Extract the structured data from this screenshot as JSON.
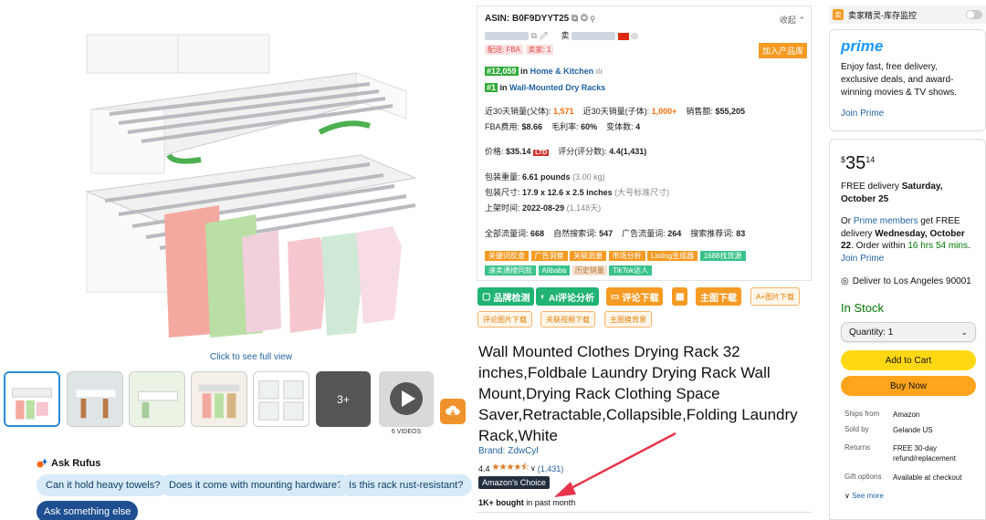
{
  "gallery": {
    "see_full": "Click to see full view",
    "more_count": "3+",
    "videos_label": "6 VIDEOS"
  },
  "rufus": {
    "title": "Ask Rufus",
    "questions": [
      "Can it hold heavy towels?",
      "Does it come with mounting hardware?",
      "Is this rack rust-resistant?"
    ],
    "ask_else": "Ask something else"
  },
  "seller": {
    "asin": "ASIN: B0F9DYYT25",
    "collapse": "收起",
    "seller_label": "卖",
    "fba_tag": "配送: FBA",
    "seller_tag": "卖家: 1",
    "add_lib": "加入产品库",
    "rank1_num": "#12,059",
    "rank1_in": "in",
    "rank1_cat": "Home & Kitchen",
    "rank2_num": "#1",
    "rank2_in": "in",
    "rank2_cat": "Wall-Mounted Dry Racks",
    "sales30_parent_label": "近30天销量(父体):",
    "sales30_parent": "1,571",
    "sales30_child_label": "近30天销量(子体):",
    "sales30_child": "1,000+",
    "revenue_label": "销售额:",
    "revenue": "$55,205",
    "fba_fee_label": "FBA费用:",
    "fba_fee": "$8.66",
    "margin_label": "毛利率:",
    "margin": "60%",
    "variants_label": "变体数:",
    "variants": "4",
    "price_label": "价格:",
    "price": "$35.14",
    "ltd": "LTD",
    "review_label": "评分(评分数):",
    "review": "4.4(1,431)",
    "weight_label": "包装重量:",
    "weight": "6.61 pounds",
    "weight_kg": "(3.00 kg)",
    "size_label": "包装尺寸:",
    "size": "17.9 x 12.6 x 2.5 inches",
    "size_std": "(大号标准尺寸)",
    "date_label": "上架时间:",
    "date": "2022-08-29",
    "date_days": "(1,148天)",
    "kw_all_label": "全部流量词:",
    "kw_all": "668",
    "kw_nat_label": "自然搜索词:",
    "kw_nat": "547",
    "kw_ad_label": "广告流量词:",
    "kw_ad": "264",
    "kw_rec_label": "搜索推荐词:",
    "kw_rec": "83",
    "tags_orange": [
      "关键词反查",
      "广告洞察",
      "关联流量",
      "市场分析",
      "Listing生成器"
    ],
    "tag_1688": "1688找货源",
    "tags_green2": [
      "速卖通搜同款",
      "Alibaba"
    ],
    "tag_history": "历史销量",
    "tag_tiktok": "TikTok达人"
  },
  "actions": {
    "brand_check": "品牌检测",
    "ai_review": "AI评论分析",
    "review_dl": "评论下载",
    "main_img_dl": "主图下载",
    "aplus_dl": "A+图片下载",
    "review_img_dl": "评论图片下载",
    "video_dl": "关联视频下载",
    "bg_swap": "主图换背景"
  },
  "product": {
    "title": "Wall Mounted Clothes Drying Rack 32 inches,Foldbale Laundry Drying Rack Wall Mount,Drying Rack Clothing Space Saver,Retractable,Collapsible,Folding Laundry Rack,White",
    "brand": "Brand: ZdwCyl",
    "rating": "4.4",
    "review_count": "(1,431)",
    "choice": "Amazon's Choice",
    "bought_bold": "1K+ bought",
    "bought_rest": " in past month"
  },
  "extension": {
    "label": "卖家精灵-库存监控"
  },
  "prime": {
    "logo": "prime",
    "text": "Enjoy fast, free delivery, exclusive deals, and award-winning movies & TV shows.",
    "join": "Join Prime"
  },
  "buybox": {
    "price_whole": "35",
    "price_frac": "14",
    "currency": "$",
    "free_delivery": "FREE delivery",
    "delivery_date": "Saturday, October 25",
    "or": "Or",
    "prime_members": "Prime members",
    "get_free": "get FREE delivery",
    "fast_date": "Wednesday, October 22",
    "order_within": ". Order within",
    "countdown": "16 hrs 54 mins",
    "join_prime": "Join Prime",
    "deliver_to": "Deliver to Los Angeles 90001",
    "in_stock": "In Stock",
    "quantity": "Quantity: 1",
    "add_to_cart": "Add to Cart",
    "buy_now": "Buy Now",
    "ships_from_label": "Ships from",
    "ships_from": "Amazon",
    "sold_by_label": "Sold by",
    "sold_by": "Gelande US",
    "returns_label": "Returns",
    "returns": "FREE 30-day refund/replacement",
    "gift_label": "Gift options",
    "gift": "Available at checkout",
    "see_more": "See more"
  },
  "colors": {
    "link": "#2162a1",
    "prime_blue": "#1a98ff",
    "cart_yellow": "#ffd814",
    "buy_orange": "#ffa41c",
    "plugin_orange": "#f59a23",
    "plugin_green": "#20b374",
    "arrow_red": "#e8344a"
  }
}
